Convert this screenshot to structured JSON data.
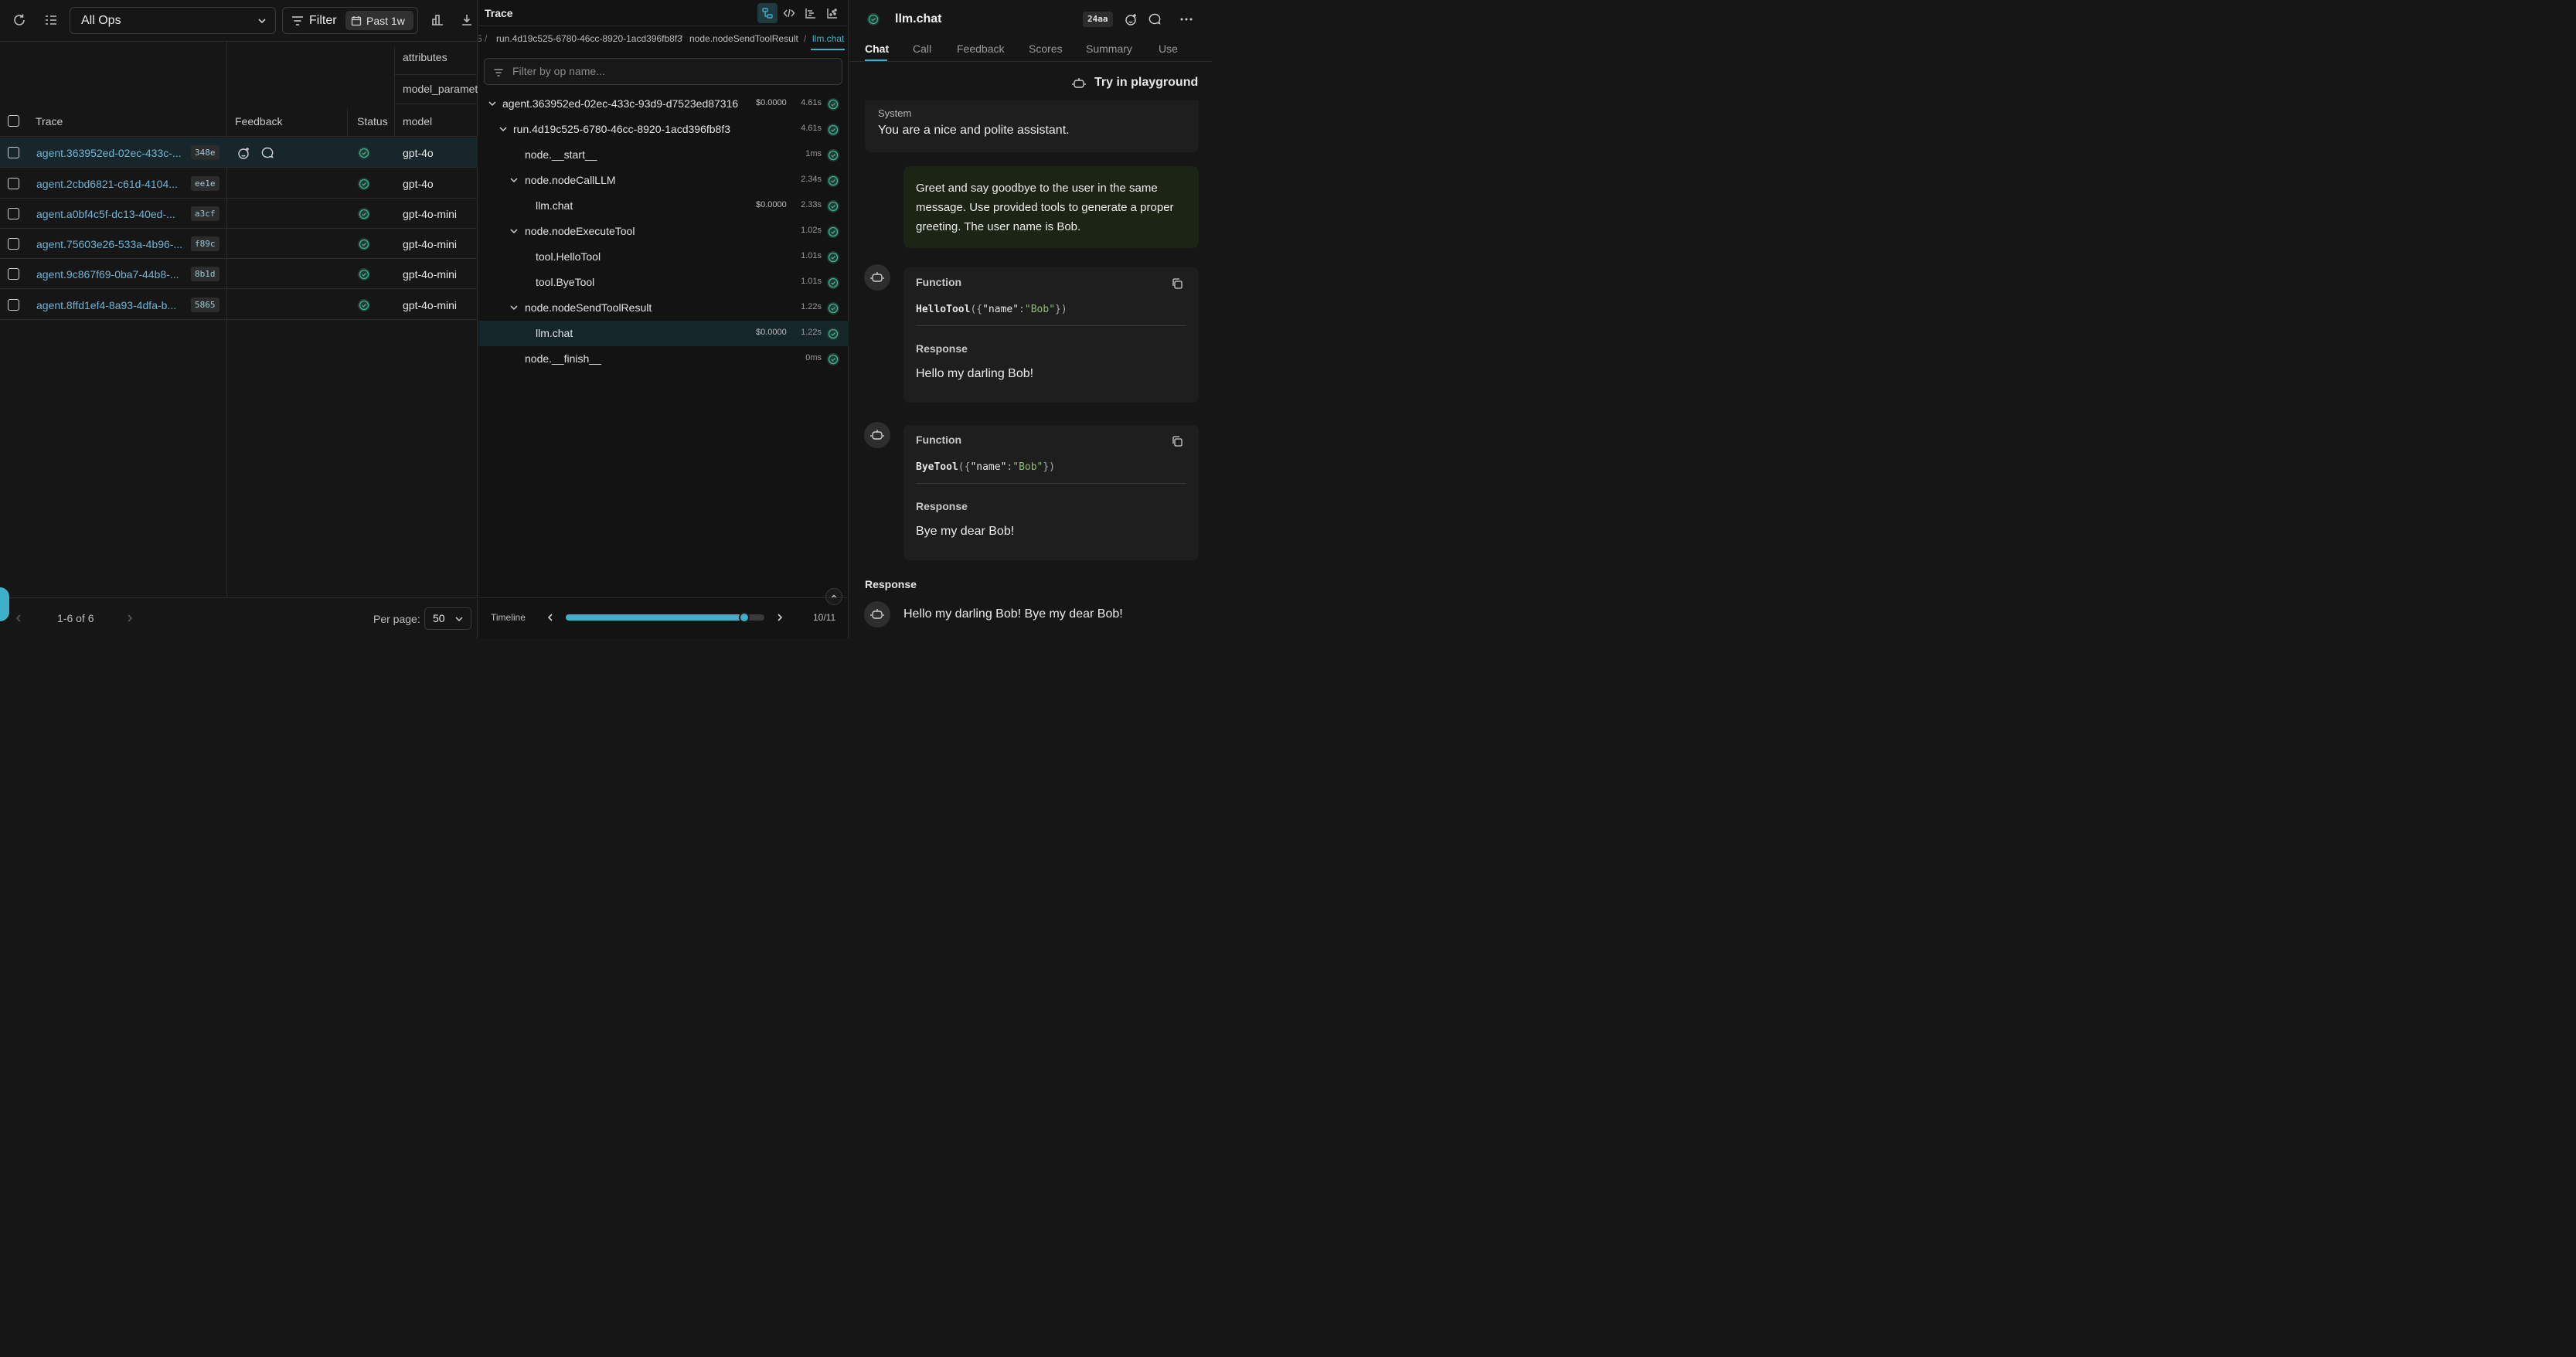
{
  "left": {
    "ops_select": "All Ops",
    "filter_label": "Filter",
    "date_chip": "Past 1w",
    "columns": {
      "attributes": "attributes",
      "model_parameters": "model_paramet",
      "trace": "Trace",
      "feedback": "Feedback",
      "status": "Status",
      "model": "model"
    },
    "rows": [
      {
        "trace": "agent.363952ed-02ec-433c-...",
        "hash": "348e",
        "model": "gpt-4o"
      },
      {
        "trace": "agent.2cbd6821-c61d-4104...",
        "hash": "ee1e",
        "model": "gpt-4o"
      },
      {
        "trace": "agent.a0bf4c5f-dc13-40ed-...",
        "hash": "a3cf",
        "model": "gpt-4o-mini"
      },
      {
        "trace": "agent.75603e26-533a-4b96-...",
        "hash": "f89c",
        "model": "gpt-4o-mini"
      },
      {
        "trace": "agent.9c867f69-0ba7-44b8-...",
        "hash": "8b1d",
        "model": "gpt-4o-mini"
      },
      {
        "trace": "agent.8ffd1ef4-8a93-4dfa-b...",
        "hash": "5865",
        "model": "gpt-4o-mini"
      }
    ],
    "pagination": {
      "range": "1-6 of 6",
      "per_page_label": "Per page:",
      "per_page": "50"
    }
  },
  "middle": {
    "title": "Trace",
    "breadcrumbs": [
      "run.4d19c525-6780-46cc-8920-1acd396fb8f3",
      "node.nodeSendToolResult",
      "llm.chat"
    ],
    "filter_placeholder": "Filter by op name...",
    "tree": [
      {
        "label": "agent.363952ed-02ec-433c-93d9-d7523ed87316",
        "cost": "$0.0000",
        "dur": "4.61s"
      },
      {
        "label": "run.4d19c525-6780-46cc-8920-1acd396fb8f3",
        "cost": "",
        "dur": "4.61s"
      },
      {
        "label": "node.__start__",
        "cost": "",
        "dur": "1ms"
      },
      {
        "label": "node.nodeCallLLM",
        "cost": "",
        "dur": "2.34s"
      },
      {
        "label": "llm.chat",
        "cost": "$0.0000",
        "dur": "2.33s"
      },
      {
        "label": "node.nodeExecuteTool",
        "cost": "",
        "dur": "1.02s"
      },
      {
        "label": "tool.HelloTool",
        "cost": "",
        "dur": "1.01s"
      },
      {
        "label": "tool.ByeTool",
        "cost": "",
        "dur": "1.01s"
      },
      {
        "label": "node.nodeSendToolResult",
        "cost": "",
        "dur": "1.22s"
      },
      {
        "label": "llm.chat",
        "cost": "$0.0000",
        "dur": "1.22s"
      },
      {
        "label": "node.__finish__",
        "cost": "",
        "dur": "0ms"
      }
    ],
    "timeline": {
      "label": "Timeline",
      "position": "10/11",
      "progress": 0.9
    }
  },
  "right": {
    "title": "llm.chat",
    "badge": "24aa",
    "tabs": [
      "Chat",
      "Call",
      "Feedback",
      "Scores",
      "Summary",
      "Use"
    ],
    "playground": "Try in playground",
    "system_label": "System",
    "system_text": "You are a nice and polite assistant.",
    "user_text": "Greet and say goodbye to the user in the same message. Use provided tools to generate a proper greeting. The user name is Bob.",
    "function_label": "Function",
    "response_label": "Response",
    "calls": [
      {
        "fn": "HelloTool",
        "arg_key": "\"name\"",
        "arg_val": "\"Bob\"",
        "response": "Hello my darling Bob!"
      },
      {
        "fn": "ByeTool",
        "arg_key": "\"name\"",
        "arg_val": "\"Bob\"",
        "response": "Bye my dear Bob!"
      }
    ],
    "final_response_label": "Response",
    "final_response": "Hello my darling Bob! Bye my dear Bob!"
  },
  "colors": {
    "accent": "#3fb0c9",
    "ok": "#3fae8c",
    "link": "#6fb4d6"
  }
}
